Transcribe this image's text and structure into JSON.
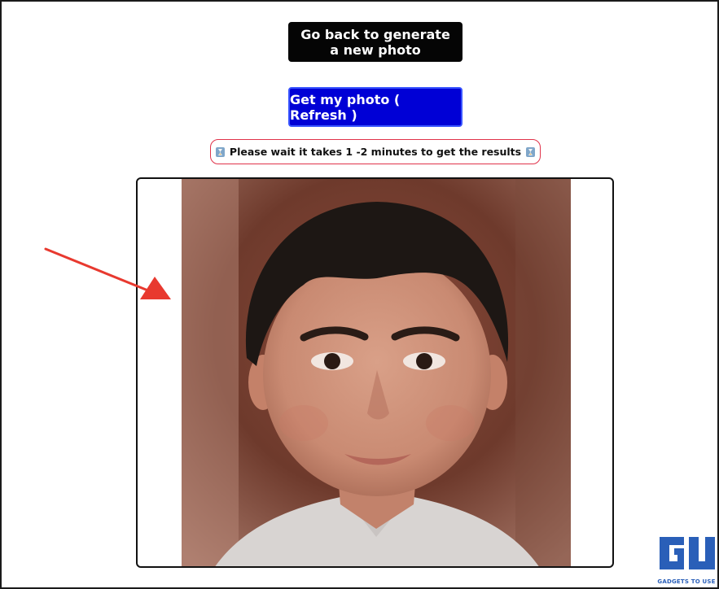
{
  "buttons": {
    "go_back_label": "Go back to generate a new photo",
    "get_photo_label": "Get my photo ( Refresh )"
  },
  "notice": {
    "text": "Please wait it takes 1 -2 minutes to get the results",
    "icon": "hourglass-icon",
    "border_color": "#e0334a"
  },
  "result": {
    "image": "generated-portrait-boy"
  },
  "annotation": {
    "icon": "arrow-icon",
    "color": "#e8392f"
  },
  "watermark": {
    "text": "GADGETS TO USE",
    "color": "#2a5fb8"
  },
  "colors": {
    "go_back_bg": "#050505",
    "get_photo_bg": "#0000d6"
  }
}
